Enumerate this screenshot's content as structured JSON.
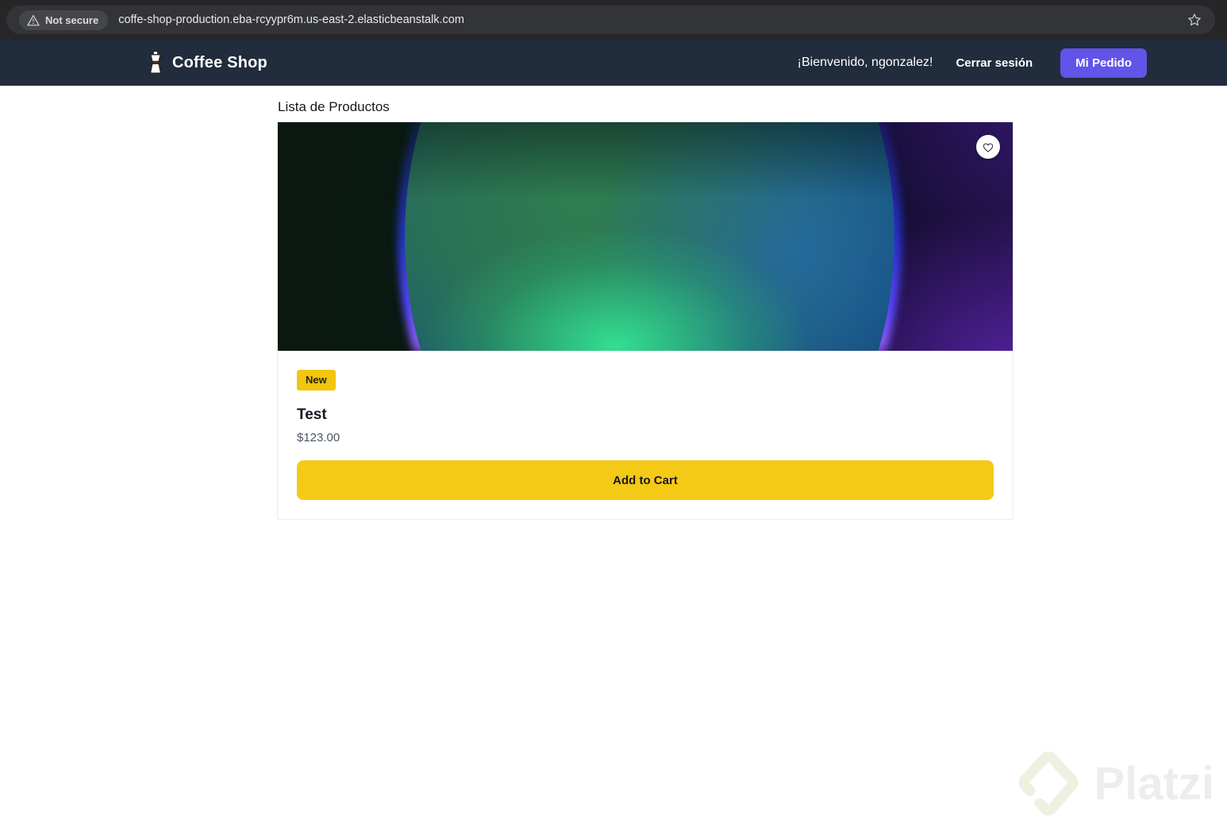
{
  "browser": {
    "security_chip": "Not secure",
    "security_icon": "warning-triangle-icon",
    "url": "coffe-shop-production.eba-rcyypr6m.us-east-2.elasticbeanstalk.com",
    "bookmark_icon": "star-outline-icon",
    "colors": {
      "bar_bg": "#262627",
      "omnibox_bg": "#333438"
    }
  },
  "navbar": {
    "brand": "Coffee Shop",
    "brand_icon": "moka-pot-icon",
    "welcome": "¡Bienvenido, ngonzalez!",
    "logout_label": "Cerrar sesión",
    "my_order_button": "Mi Pedido",
    "colors": {
      "bg": "#212c3c",
      "order_button_bg": "#6254e8"
    }
  },
  "main": {
    "heading": "Lista de Productos",
    "product": {
      "badge": "New",
      "title": "Test",
      "price": "$123.00",
      "add_to_cart_label": "Add to Cart",
      "favorite_icon": "heart-outline-icon",
      "colors": {
        "badge_bg": "#f2c50f",
        "button_bg": "#f5ca16"
      }
    }
  },
  "watermark": {
    "brand": "Platzi",
    "logo_icon": "platzi-diamond-icon"
  }
}
